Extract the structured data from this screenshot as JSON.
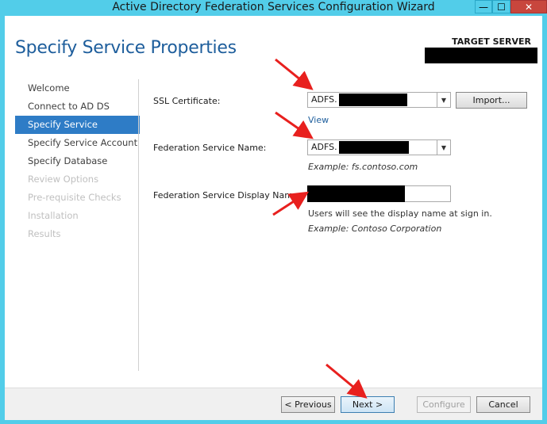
{
  "window": {
    "title": "Active Directory Federation Services Configuration Wizard",
    "controls": {
      "minimize": "—",
      "maximize": "☐",
      "close": "✕"
    }
  },
  "header": {
    "page_title": "Specify Service Properties",
    "target_server_label": "TARGET SERVER"
  },
  "nav": {
    "items": [
      {
        "label": "Welcome",
        "state": "normal"
      },
      {
        "label": "Connect to AD DS",
        "state": "normal"
      },
      {
        "label": "Specify Service Properties",
        "state": "active"
      },
      {
        "label": "Specify Service Account",
        "state": "normal"
      },
      {
        "label": "Specify Database",
        "state": "normal"
      },
      {
        "label": "Review Options",
        "state": "disabled"
      },
      {
        "label": "Pre-requisite Checks",
        "state": "disabled"
      },
      {
        "label": "Installation",
        "state": "disabled"
      },
      {
        "label": "Results",
        "state": "disabled"
      }
    ]
  },
  "form": {
    "ssl_label": "SSL Certificate:",
    "ssl_value": "ADFS.",
    "import_label": "Import...",
    "view_link": "View",
    "fs_name_label": "Federation Service Name:",
    "fs_name_value": "ADFS.",
    "fs_name_example": "Example: fs.contoso.com",
    "display_name_label": "Federation Service Display Name:",
    "display_name_note": "Users will see the display name at sign in.",
    "display_name_example": "Example: Contoso Corporation"
  },
  "footer": {
    "previous": "< Previous",
    "next": "Next >",
    "configure": "Configure",
    "cancel": "Cancel"
  },
  "colors": {
    "titlebar": "#52cde9",
    "accent": "#2e7cc6",
    "annotation_arrow": "#e8201e"
  }
}
